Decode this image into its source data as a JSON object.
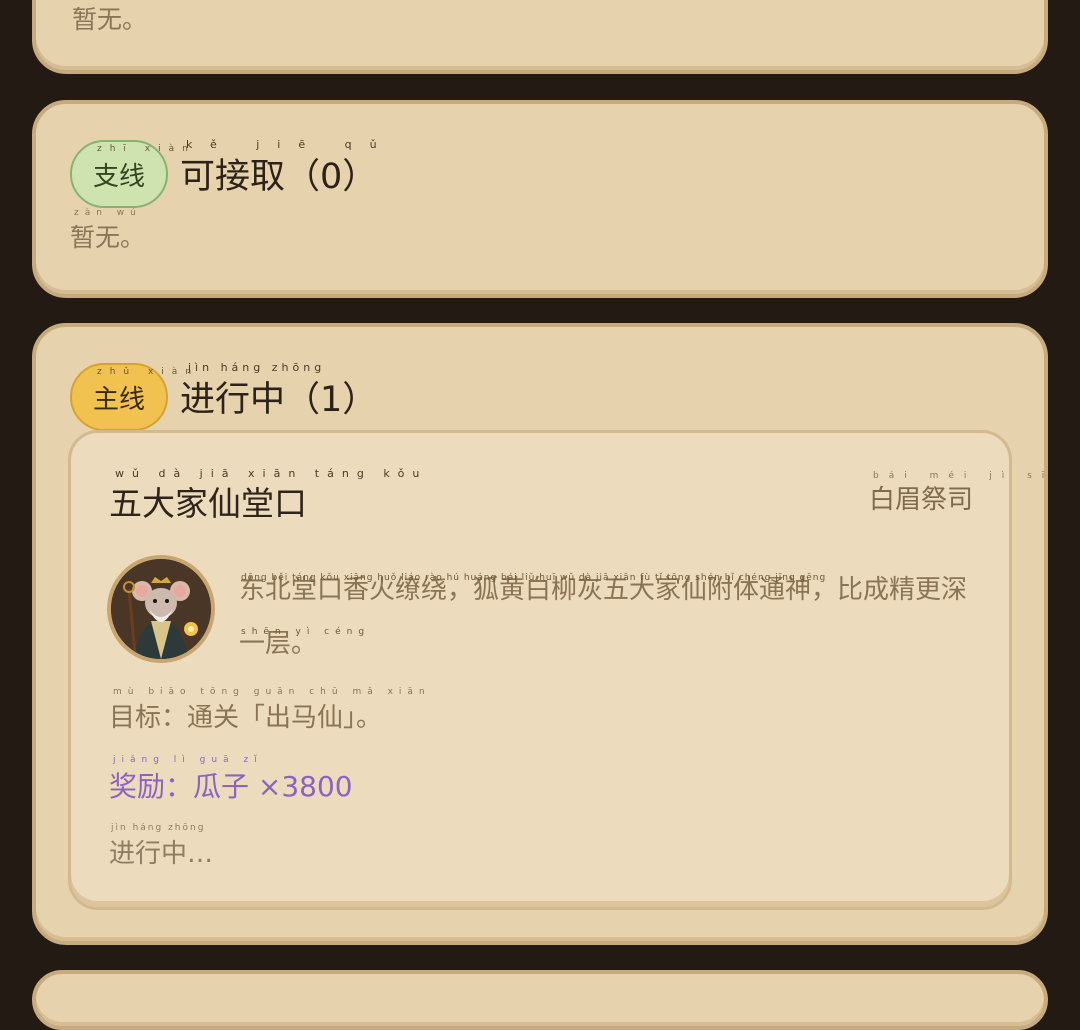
{
  "top_panel": {
    "empty_text": "暂无。"
  },
  "side_panel": {
    "tag": "支线",
    "tag_pinyin": "zhī xiàn",
    "title": "可接取（0）",
    "title_pinyin": "kě jiē qǔ",
    "empty_text": "暂无。",
    "empty_pinyin": "zàn wú"
  },
  "main_panel": {
    "tag": "主线",
    "tag_pinyin": "zhǔ xiàn",
    "title": "进行中（1）",
    "title_pinyin": "jìn háng zhōng"
  },
  "quest": {
    "title": "五大家仙堂口",
    "title_pinyin": "wǔ dà jiā xiān táng kǒu",
    "npc": "白眉祭司",
    "npc_pinyin": "bái méi jì sī",
    "description": "东北堂口香火缭绕，狐黄白柳灰五大家仙附体通神，比成精更深一层。",
    "description_pinyin_line1": "dōng běi táng kǒu xiāng huǒ liáo rào   hú huáng bái liǔ huī wǔ dà jiā xiān fù tǐ tōng shén   bǐ chéng jīng gēng",
    "description_pinyin_line2": "shēn yì céng",
    "goal": "目标：通关「出马仙」。",
    "goal_pinyin": "mù biāo   tōng guān   chū mǎ xiān",
    "reward": "奖励：瓜子 ×3800",
    "reward_pinyin": "jiǎng lì   guā zǐ",
    "status": "进行中…",
    "status_pinyin": "jìn háng zhōng"
  },
  "colors": {
    "page_bg": "#231a14",
    "panel_bg": "#e6d2ad",
    "side_tag": "#cfe3b1",
    "main_tag": "#f1c24f",
    "reward": "#8d63c0"
  },
  "icons": {
    "avatar": "white-eyebrow-priest-rat-avatar"
  }
}
